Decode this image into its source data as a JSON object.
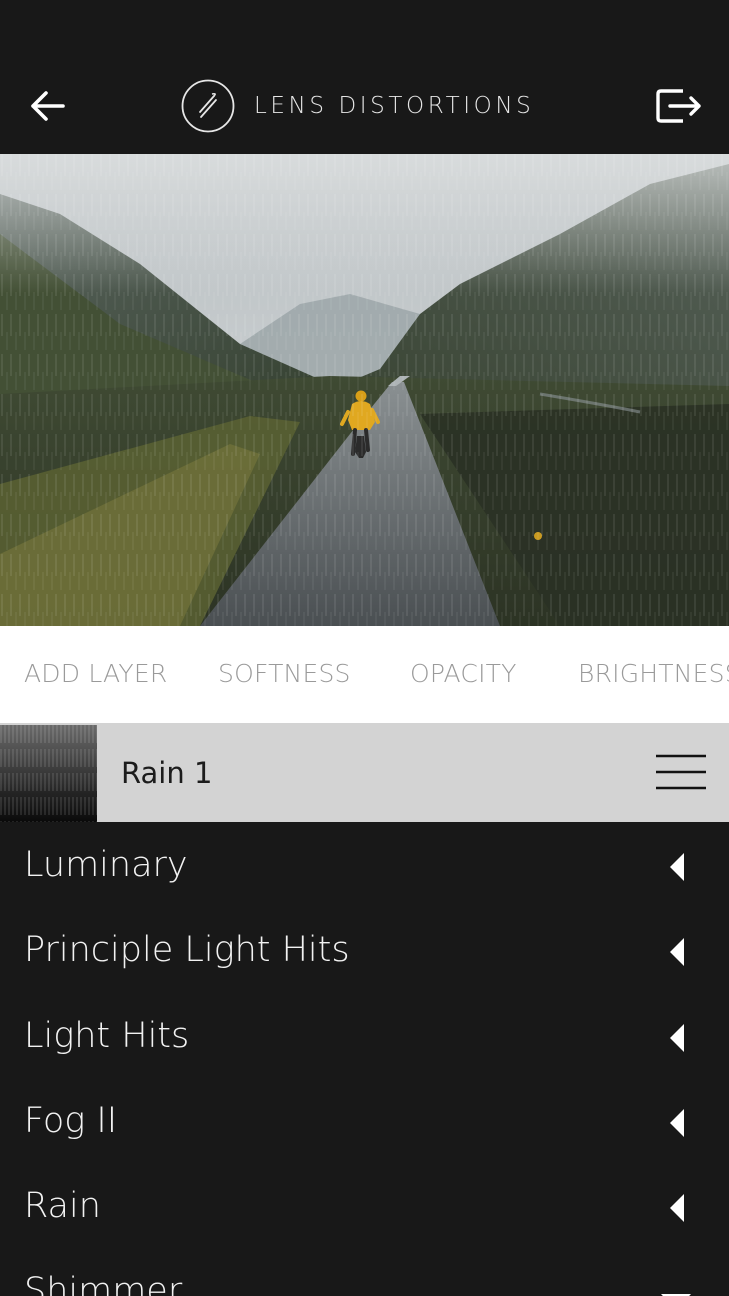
{
  "header": {
    "title": "LENS DISTORTIONS",
    "back_icon": "arrow-left-icon",
    "export_icon": "export-icon",
    "logo_icon": "lens-distortions-logo"
  },
  "photo": {
    "subject": "person in yellow raincoat running on wet road through misty valley with rain overlay"
  },
  "toolbar": {
    "items": [
      "ADD LAYER",
      "SOFTNESS",
      "OPACITY",
      "BRIGHTNESS"
    ]
  },
  "layer": {
    "name": "Rain 1",
    "menu_icon": "hamburger-menu-icon"
  },
  "categories": [
    {
      "label": "Luminary",
      "state": "collapsed"
    },
    {
      "label": "Principle Light Hits",
      "state": "collapsed"
    },
    {
      "label": "Light Hits",
      "state": "collapsed"
    },
    {
      "label": "Fog II",
      "state": "collapsed"
    },
    {
      "label": "Rain",
      "state": "collapsed"
    },
    {
      "label": "Shimmer",
      "state": "expanded"
    }
  ],
  "colors": {
    "background": "#181818",
    "toolbar_bg": "#ffffff",
    "toolbar_text": "#9a9a9a",
    "layer_row_bg": "#d3d3d3",
    "list_text": "#f2f2f2",
    "raincoat": "#e0a820"
  }
}
